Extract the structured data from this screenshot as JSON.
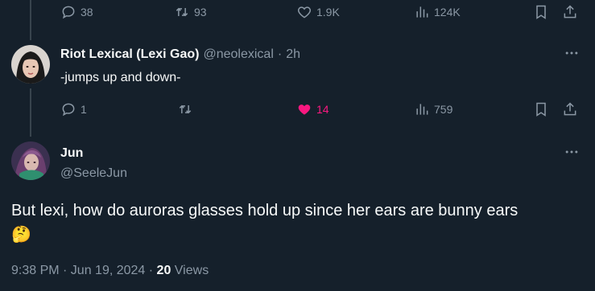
{
  "top_actions": {
    "replies": "38",
    "reposts": "93",
    "likes": "1.9K",
    "views": "124K"
  },
  "reply": {
    "display_name": "Riot Lexical (Lexi Gao)",
    "handle": "@neolexical",
    "separator": "·",
    "time": "2h",
    "text": "-jumps up and down-",
    "actions": {
      "replies": "1",
      "reposts": "",
      "likes": "14",
      "views": "759"
    }
  },
  "main_post": {
    "display_name": "Jun",
    "handle": "@SeeleJun",
    "text": "But lexi, how do auroras glasses hold up since her ears are bunny ears",
    "emoji": "🤔",
    "timestamp": "9:38 PM · Jun 19, 2024 · ",
    "views_count": "20",
    "views_label": "Views"
  },
  "colors": {
    "background": "#15202b",
    "muted": "#8b98a5",
    "like_pink": "#f91880",
    "text": "#f7f9f9"
  },
  "icons": [
    "reply-icon",
    "repost-icon",
    "heart-icon",
    "views-icon",
    "bookmark-icon",
    "share-icon",
    "more-icon"
  ]
}
